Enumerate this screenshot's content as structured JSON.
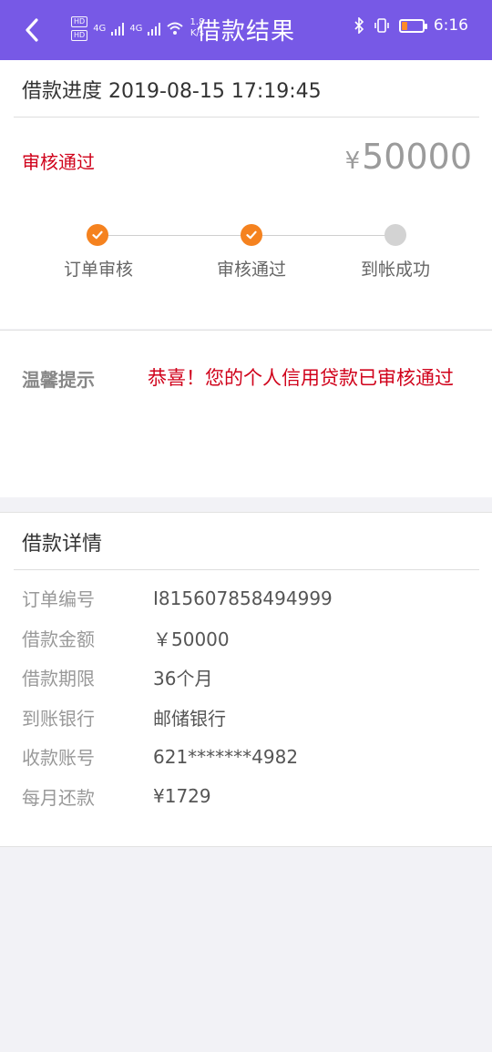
{
  "status_bar": {
    "network_labels": [
      "HD",
      "HD",
      "4G",
      "4G"
    ],
    "speed_value": "1.8",
    "speed_unit": "K/s",
    "time": "6:16",
    "battery_level": 0.3
  },
  "header": {
    "title": "借款结果",
    "back_icon": "chevron-left-icon"
  },
  "progress": {
    "header_label": "借款进度",
    "datetime": "2019-08-15 17:19:45",
    "status": "审核通过",
    "currency": "¥",
    "amount": "50000",
    "steps": [
      {
        "label": "订单审核",
        "done": true
      },
      {
        "label": "审核通过",
        "done": true
      },
      {
        "label": "到帐成功",
        "done": false
      }
    ]
  },
  "tip": {
    "label": "温馨提示",
    "content": "恭喜！您的个人信用贷款已审核通过"
  },
  "details": {
    "title": "借款详情",
    "rows": [
      {
        "key": "订单编号",
        "value": "I815607858494999"
      },
      {
        "key": "借款金额",
        "value": "￥50000"
      },
      {
        "key": "借款期限",
        "value": "36个月"
      },
      {
        "key": "到账银行",
        "value": "邮储银行"
      },
      {
        "key": "收款账号",
        "value": "621*******4982"
      },
      {
        "key": "每月还款",
        "value": "¥1729"
      }
    ]
  },
  "colors": {
    "header_bg": "#7759e6",
    "accent_orange": "#f5821f",
    "alert_red": "#d0021b"
  }
}
